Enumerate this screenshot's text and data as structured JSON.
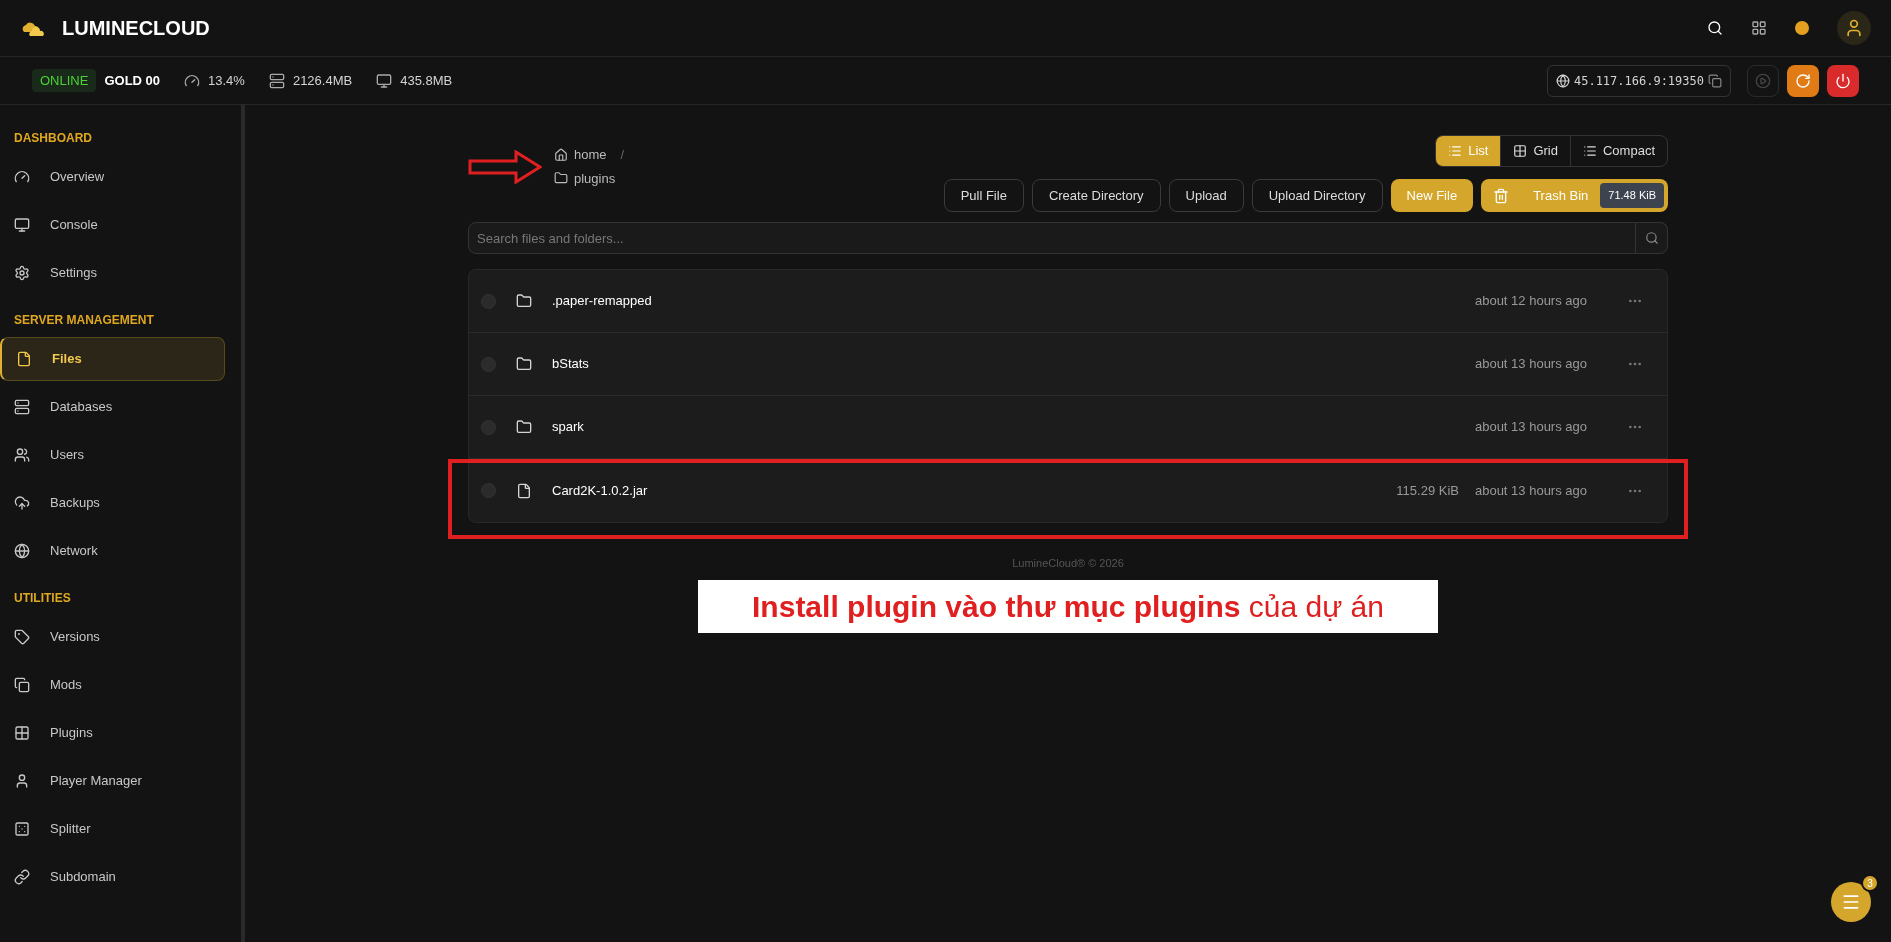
{
  "brand": {
    "name": "LUMINECLOUD"
  },
  "status_bar": {
    "status": "ONLINE",
    "server": "GOLD 00",
    "cpu": "13.4%",
    "memory": "2126.4MB",
    "disk": "435.8MB",
    "address": "45.117.166.9:19350"
  },
  "sidebar": {
    "groups": [
      {
        "title": "DASHBOARD",
        "items": [
          {
            "label": "Overview",
            "selected": false
          },
          {
            "label": "Console",
            "selected": false
          },
          {
            "label": "Settings",
            "selected": false
          }
        ]
      },
      {
        "title": "SERVER MANAGEMENT",
        "items": [
          {
            "label": "Files",
            "selected": true
          },
          {
            "label": "Databases",
            "selected": false
          },
          {
            "label": "Users",
            "selected": false
          },
          {
            "label": "Backups",
            "selected": false
          },
          {
            "label": "Network",
            "selected": false
          }
        ]
      },
      {
        "title": "UTILITIES",
        "items": [
          {
            "label": "Versions",
            "selected": false
          },
          {
            "label": "Mods",
            "selected": false
          },
          {
            "label": "Plugins",
            "selected": false
          },
          {
            "label": "Player Manager",
            "selected": false
          },
          {
            "label": "Splitter",
            "selected": false
          },
          {
            "label": "Subdomain",
            "selected": false
          }
        ]
      }
    ]
  },
  "breadcrumb": {
    "items": [
      "home",
      "plugins"
    ],
    "separator": "/"
  },
  "views": [
    {
      "label": "List",
      "selected": true
    },
    {
      "label": "Grid",
      "selected": false
    },
    {
      "label": "Compact",
      "selected": false
    }
  ],
  "actions": [
    {
      "label": "Pull File",
      "kind": "outline"
    },
    {
      "label": "Create Directory",
      "kind": "outline"
    },
    {
      "label": "Upload",
      "kind": "outline"
    },
    {
      "label": "Upload Directory",
      "kind": "outline"
    },
    {
      "label": "New File",
      "kind": "primary"
    }
  ],
  "trash": {
    "label": "Trash Bin",
    "size": "71.48 KiB"
  },
  "search": {
    "placeholder": "Search files and folders..."
  },
  "files": [
    {
      "kind": "folder",
      "name": ".paper-remapped",
      "modified": "about 12 hours ago",
      "checked": false
    },
    {
      "kind": "folder",
      "name": "bStats",
      "modified": "about 13 hours ago",
      "checked": false
    },
    {
      "kind": "folder",
      "name": "spark",
      "modified": "about 13 hours ago",
      "checked": false
    },
    {
      "kind": "file",
      "name": "Card2K-1.0.2.jar",
      "size": "115.29 KiB",
      "modified": "about 13 hours ago",
      "checked": false
    }
  ],
  "footer": "LumineCloud® © 2026",
  "annotation": {
    "caption": "**Install plugin vào thư mục plugins** của dự án"
  },
  "notifications": {
    "count": "3"
  }
}
